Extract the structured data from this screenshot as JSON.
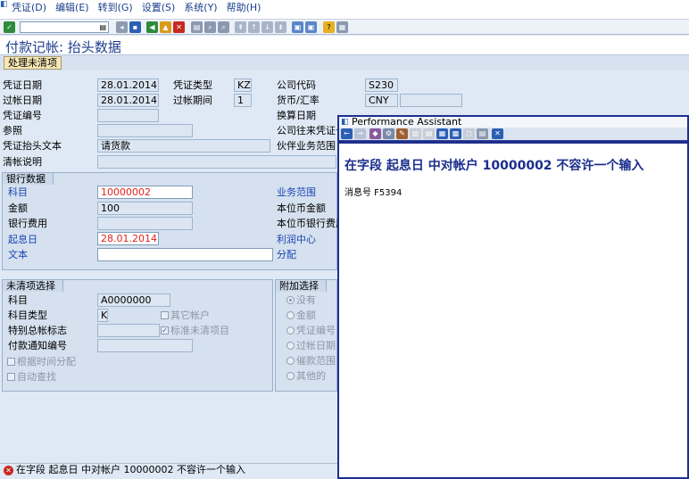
{
  "menu": [
    "凭证(D)",
    "编辑(E)",
    "转到(G)",
    "设置(S)",
    "系统(Y)",
    "帮助(H)"
  ],
  "title": "付款记帐: 抬头数据",
  "app_button": "处理未清项",
  "header": {
    "doc_date_label": "凭证日期",
    "doc_date": "28.01.2014",
    "doc_type_label": "凭证类型",
    "doc_type": "KZ",
    "company_label": "公司代码",
    "company": "S230",
    "post_date_label": "过帐日期",
    "post_date": "28.01.2014",
    "period_label": "过帐期间",
    "period": "1",
    "currency_label": "货币/汇率",
    "currency": "CNY",
    "docno_label": "凭证编号",
    "exrate_label": "换算日期",
    "ref_label": "参照",
    "intercompany_label": "公司往来凭证号",
    "headertext_label": "凭证抬头文本",
    "headertext": "请货款",
    "partner_label": "伙伴业务范围",
    "clearing_label": "清帐说明"
  },
  "bank": {
    "group": "银行数据",
    "account_label": "科目",
    "account": "10000002",
    "amount_label": "金额",
    "amount": "100",
    "charges_label": "银行费用",
    "value_date_label": "起息日",
    "value_date": "28.01.2014",
    "text_label": "文本",
    "ba_label": "业务范围",
    "lc_amount_label": "本位币金额",
    "lc_charges_label": "本位币银行费用",
    "profit_label": "利润中心",
    "assign_label": "分配"
  },
  "open_items": {
    "group": "未清项选择",
    "account_label": "科目",
    "account": "A0000000",
    "acct_type_label": "科目类型",
    "acct_type": "K",
    "other_acct": "其它帐户",
    "special_gl_label": "特别总帐标志",
    "std_items": "标准未清项目",
    "pay_advice_label": "付款通知编号",
    "distribute": "根据时间分配",
    "auto_search": "自动查找"
  },
  "additional": {
    "group": "附加选择",
    "options": [
      "没有",
      "金额",
      "凭证编号",
      "过帐日期",
      "催款范围",
      "其他的"
    ]
  },
  "status": "在字段 起息日 中对帐户 10000002 不容许一个输入",
  "assistant": {
    "title": "Performance Assistant",
    "message": "在字段  起息日  中对帐户  10000002 不容许一个输入",
    "msg_no": "消息号 F5394"
  },
  "colors": {
    "title": "#1f3f8e",
    "error": "#c8281e",
    "popup_border": "#1c2f8e"
  }
}
